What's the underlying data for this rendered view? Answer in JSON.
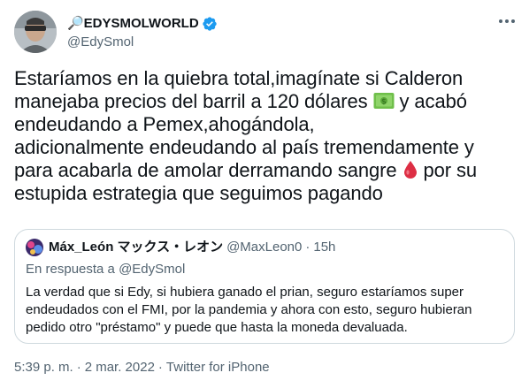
{
  "author": {
    "display_name": "🔎EDYSMOLWORLD",
    "handle": "@EdySmol",
    "verified": true,
    "avatar_icon": "user-avatar-photo"
  },
  "tweet": {
    "lines": [
      "Estaríamos en la quiebra total,imagínate si Calderon",
      "manejaba precios del barril a 120 dólares ",
      "endeudando a Pemex,ahogándola,",
      "adicionalmente endeudando al país tremendamente y",
      "para acabarla de amolar derramando sangre ",
      "estupida estrategia que seguimos pagando"
    ],
    "line2_after_emoji": " y acabó",
    "line5_after_emoji": "  por su",
    "emoji_money": "money-with-wings-icon",
    "emoji_drop": "drop-of-blood-icon"
  },
  "quote": {
    "display_name": "Máx_León マックス・レオン",
    "handle": "@MaxLeon0",
    "dot": "·",
    "time": "15h",
    "reply_prefix": "En respuesta a ",
    "reply_to": "@EdySmol",
    "lines": [
      "La verdad que si Edy, si hubiera ganado el prian, seguro estaríamos super",
      "endeudados con el FMI, por la pandemia y ahora con esto, seguro hubieran",
      "pedido otro \"préstamo\" y puede que hasta la moneda devaluada."
    ]
  },
  "meta": {
    "time": "5:39 p. m.",
    "sep1": "·",
    "date": "2 mar. 2022",
    "sep2": "·",
    "source": "Twitter for iPhone"
  },
  "colors": {
    "text_primary": "#0f1419",
    "text_secondary": "#536471",
    "border": "#cfd9de",
    "verified_blue": "#1d9bf0"
  }
}
